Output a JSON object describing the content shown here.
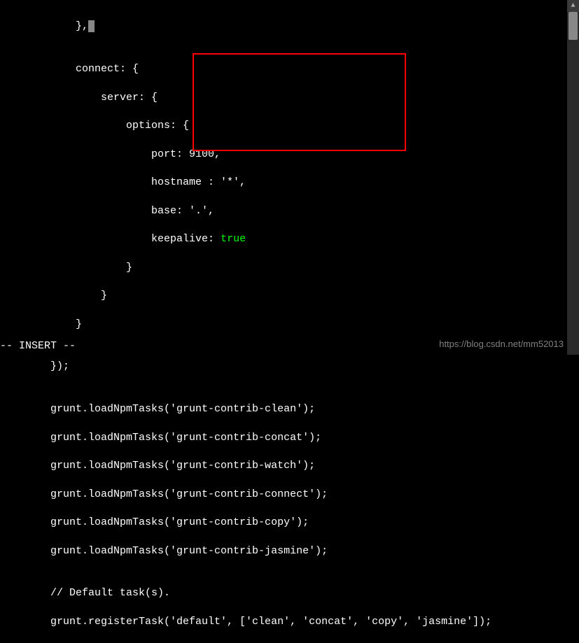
{
  "code": {
    "l1": "            },",
    "l2": "",
    "l3": "            connect: {",
    "l4": "                server: {",
    "l5": "                    options: {",
    "l6": "                        port: 9100,",
    "l7": "                        hostname : '*',",
    "l8": "                        base: '.',",
    "l9_prefix": "                        keepalive: ",
    "l9_true": "true",
    "l10": "                    }",
    "l11": "                }",
    "l12": "            }",
    "l13": "",
    "l14": "        });",
    "l15": "",
    "l16": "        grunt.loadNpmTasks('grunt-contrib-clean');",
    "l17": "        grunt.loadNpmTasks('grunt-contrib-concat');",
    "l18": "        grunt.loadNpmTasks('grunt-contrib-watch');",
    "l19": "        grunt.loadNpmTasks('grunt-contrib-connect');",
    "l20": "        grunt.loadNpmTasks('grunt-contrib-copy');",
    "l21": "        grunt.loadNpmTasks('grunt-contrib-jasmine');",
    "l22": "",
    "l23": "        // Default task(s).",
    "l24": "        grunt.registerTask('default', ['clean', 'concat', 'copy', 'jasmine']);"
  },
  "cursor_char": " ",
  "status": "-- INSERT --",
  "watermark": "https://blog.csdn.net/mm52013",
  "scrollbar_arrow": "▲"
}
